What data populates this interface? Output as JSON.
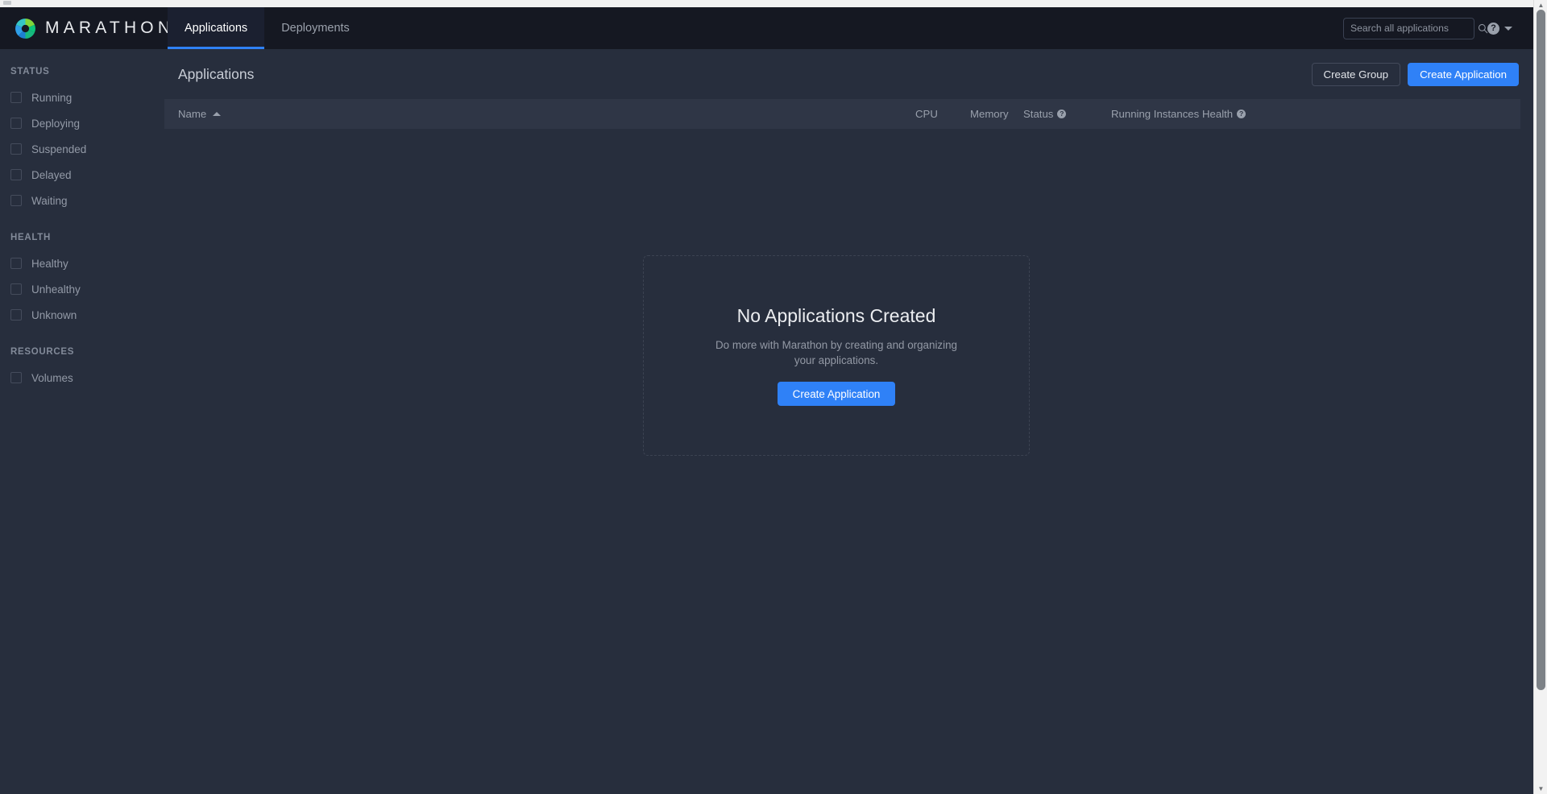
{
  "navbar": {
    "brand_title": "MARATHON",
    "logo_icon": "marathon-donut-logo",
    "tabs": [
      {
        "label": "Applications",
        "active": true
      },
      {
        "label": "Deployments",
        "active": false
      }
    ],
    "search": {
      "placeholder": "Search all applications",
      "value": "",
      "icon": "search-icon"
    },
    "help": {
      "icon": "question-mark-icon",
      "glyph": "?",
      "caret_icon": "chevron-down-icon"
    }
  },
  "sidebar": {
    "groups": [
      {
        "title": "STATUS",
        "items": [
          {
            "label": "Running",
            "checked": false
          },
          {
            "label": "Deploying",
            "checked": false
          },
          {
            "label": "Suspended",
            "checked": false
          },
          {
            "label": "Delayed",
            "checked": false
          },
          {
            "label": "Waiting",
            "checked": false
          }
        ]
      },
      {
        "title": "HEALTH",
        "items": [
          {
            "label": "Healthy",
            "checked": false
          },
          {
            "label": "Unhealthy",
            "checked": false
          },
          {
            "label": "Unknown",
            "checked": false
          }
        ]
      },
      {
        "title": "RESOURCES",
        "items": [
          {
            "label": "Volumes",
            "checked": false
          }
        ]
      }
    ]
  },
  "content": {
    "page_title": "Applications",
    "actions": {
      "create_group_label": "Create Group",
      "create_application_label": "Create Application"
    },
    "table": {
      "columns": [
        {
          "label": "Name",
          "sorted": true,
          "sort_direction": "asc",
          "help": false
        },
        {
          "label": "CPU",
          "sorted": false,
          "help": false
        },
        {
          "label": "Memory",
          "sorted": false,
          "help": false
        },
        {
          "label": "Status",
          "sorted": false,
          "help": true
        },
        {
          "label": "Running Instances",
          "sorted": false,
          "help": false
        },
        {
          "label": "Health",
          "sorted": false,
          "help": true
        }
      ],
      "rows": []
    },
    "empty_state": {
      "title": "No Applications Created",
      "description": "Do more with Marathon by creating and organizing your applications.",
      "button_label": "Create Application"
    }
  },
  "scrollbar": {
    "up_arrow": "▲",
    "down_arrow": "▼"
  },
  "colors": {
    "accent_blue": "#2f81f7",
    "navbar_bg": "#151822",
    "app_bg": "#272e3d",
    "table_header_bg": "#2f3646",
    "text_primary": "#eceef1",
    "text_muted": "#939aa7"
  }
}
